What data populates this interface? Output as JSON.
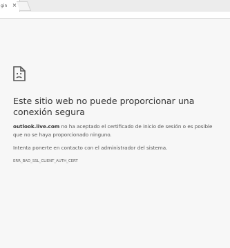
{
  "browser": {
    "tab_title": "gin",
    "tab_close_glyph": "×"
  },
  "error": {
    "icon": "sad-document-icon",
    "title": "Este sitio web no puede proporcionar una conexión segura",
    "domain": "outlook.live.com",
    "description_rest": " no ha aceptado el certificado de inicio de sesión o es posible que no se haya proporcionado ninguno.",
    "hint": "Intenta ponerte en contacto con el administrador del sistema.",
    "code": "ERR_BAD_SSL_CLIENT_AUTH_CERT"
  }
}
